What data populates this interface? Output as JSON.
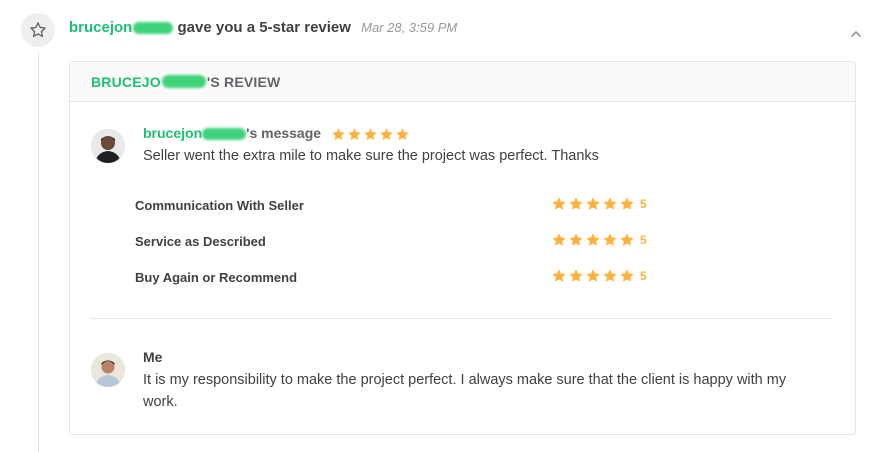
{
  "header": {
    "username_prefix": "brucejon",
    "action": "gave you a 5-star review",
    "time": "Mar 28, 3:59 PM"
  },
  "card": {
    "title_prefix": "BRUCEJO",
    "title_suffix": "'S REVIEW"
  },
  "buyer_message": {
    "name_prefix": "brucejon",
    "name_suffix": "'s message",
    "stars": 5,
    "text": "Seller went the extra mile to make sure the project was perfect. Thanks"
  },
  "ratings": [
    {
      "label": "Communication With Seller",
      "value": "5"
    },
    {
      "label": "Service as Described",
      "value": "5"
    },
    {
      "label": "Buy Again or Recommend",
      "value": "5"
    }
  ],
  "reply": {
    "name": "Me",
    "text": "It is my responsibility to make the project perfect. I always make sure that the client is happy with my work."
  },
  "colors": {
    "accent_green": "#1dbf73",
    "star_yellow": "#ffb33e",
    "muted_text": "#95979d"
  },
  "icons": [
    "star-outline-icon",
    "chevron-up-icon",
    "star-icon"
  ]
}
